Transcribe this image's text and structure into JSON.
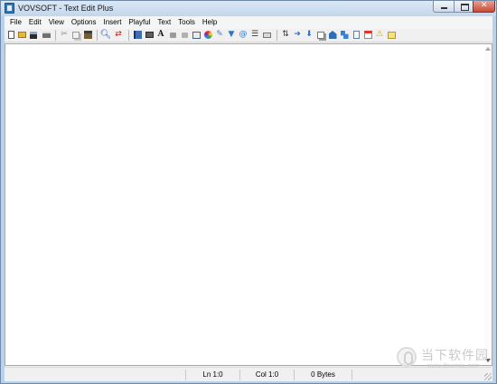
{
  "window": {
    "title": "VOVSOFT - Text Edit Plus"
  },
  "menu": {
    "items": [
      "File",
      "Edit",
      "View",
      "Options",
      "Insert",
      "Playful",
      "Text",
      "Tools",
      "Help"
    ]
  },
  "toolbar": {
    "groups": [
      [
        "new-file-icon",
        "open-folder-icon",
        "save-icon",
        "print-icon"
      ],
      [
        "cut-icon",
        "copy-icon",
        "paste-icon"
      ],
      [
        "find-icon",
        "replace-icon"
      ],
      [
        "book-icon",
        "keyboard-icon",
        "font-icon",
        "lock-icon",
        "unlock-icon",
        "image-icon",
        "color-wheel-icon",
        "brush-icon",
        "filter-icon",
        "email-icon",
        "list-icon",
        "keyboard-icon-2"
      ],
      [
        "sort-icon",
        "arrow-right-icon",
        "arrow-down-icon",
        "copy-pages-icon",
        "blue-shape-icon",
        "network-icon",
        "document-icon",
        "calendar-icon",
        "warning-icon",
        "note-icon"
      ]
    ]
  },
  "status": {
    "line": "Ln 1:0",
    "column": "Col 1:0",
    "size": "0 Bytes"
  },
  "watermark": {
    "title": "当下软件园",
    "url": "www.downxia.com"
  },
  "colors": {
    "title_bar": "#c3d6ec",
    "close_button": "#c94a36",
    "editor_background": "#ffffff"
  }
}
